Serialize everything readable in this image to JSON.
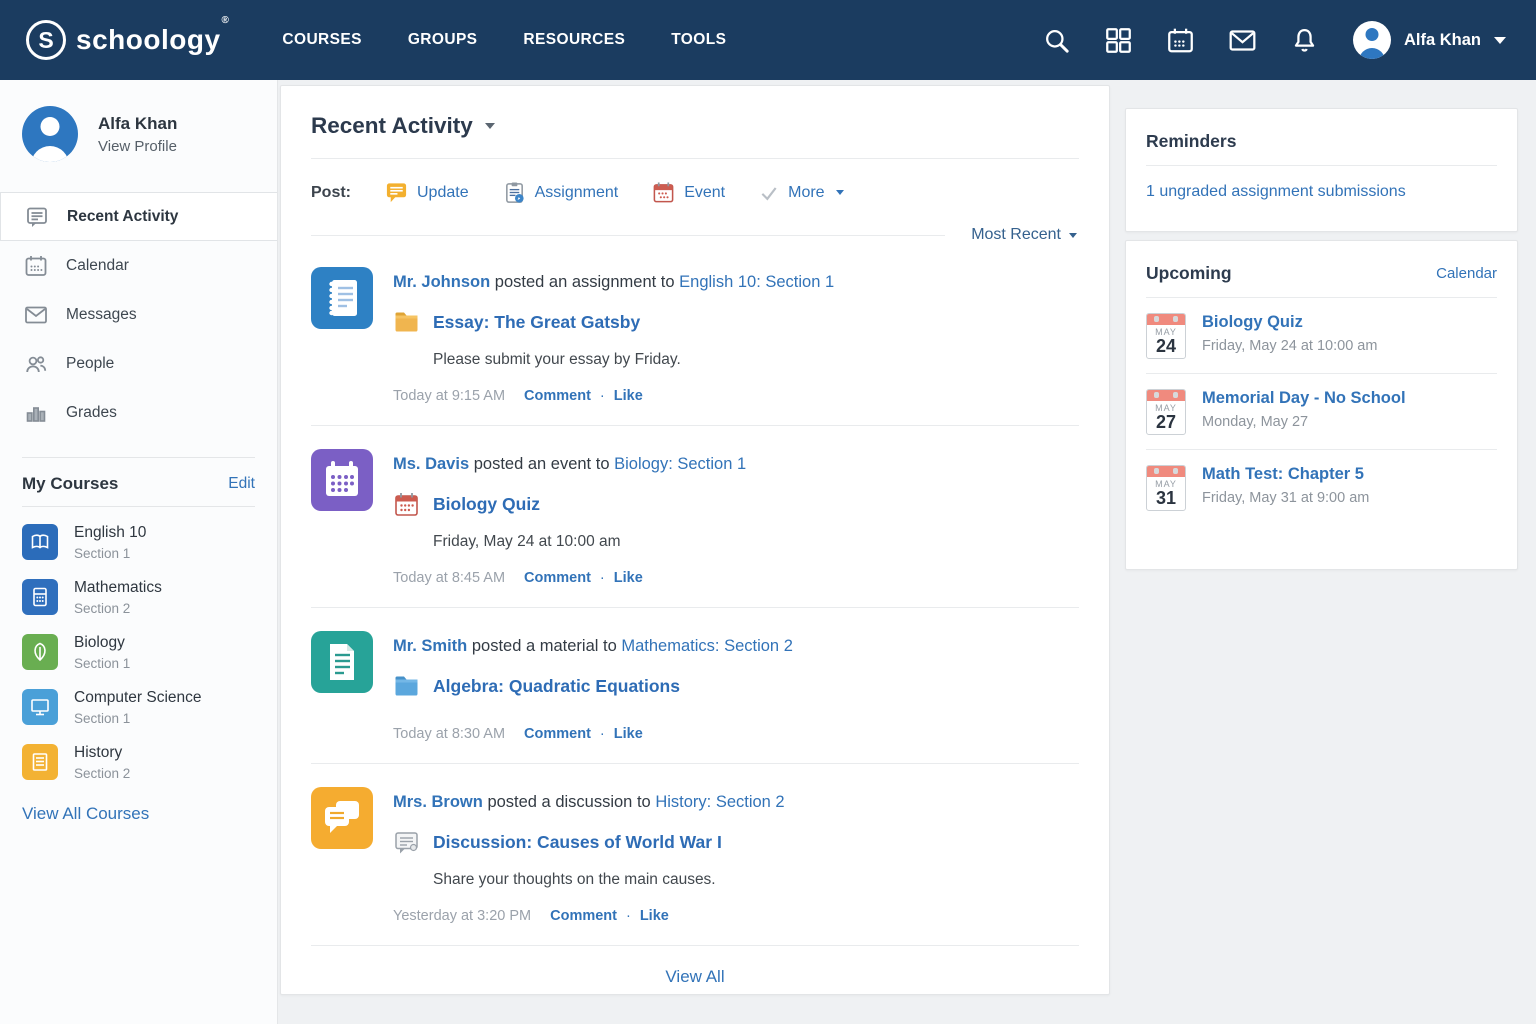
{
  "colors": {
    "navbar": "#1b3c60",
    "link": "#3273b8",
    "tile_assignment": "#2e81c4",
    "tile_event": "#7b5fc5",
    "tile_material": "#27a398",
    "tile_discussion": "#f5ac30",
    "course_english": "#2b6cba",
    "course_math": "#2f6fbd",
    "course_biology": "#69ae51",
    "course_cs": "#4aa0d8",
    "course_history": "#f3b233"
  },
  "navbar": {
    "brand": "schoology",
    "brand_mark": "®",
    "brand_initial": "S",
    "links": [
      {
        "label": "COURSES"
      },
      {
        "label": "GROUPS"
      },
      {
        "label": "RESOURCES"
      },
      {
        "label": "TOOLS"
      }
    ],
    "icons": [
      "search",
      "app-grid",
      "calendar",
      "messages",
      "notifications"
    ],
    "user_name": "Alfa Khan"
  },
  "sidebar": {
    "profile": {
      "name": "Alfa Khan",
      "link": "View Profile"
    },
    "items": [
      {
        "label": "Recent Activity",
        "icon": "post",
        "selected": true
      },
      {
        "label": "Calendar",
        "icon": "calendar",
        "selected": false
      },
      {
        "label": "Messages",
        "icon": "envelope",
        "selected": false
      },
      {
        "label": "People",
        "icon": "people",
        "selected": false
      },
      {
        "label": "Grades",
        "icon": "bar-chart",
        "selected": false
      }
    ],
    "courses": {
      "title": "My Courses",
      "edit": "Edit",
      "list": [
        {
          "name": "English 10",
          "section": "Section 1"
        },
        {
          "name": "Mathematics",
          "section": "Section 2"
        },
        {
          "name": "Biology",
          "section": "Section 1"
        },
        {
          "name": "Computer Science",
          "section": "Section 1"
        },
        {
          "name": "History",
          "section": "Section 2"
        }
      ],
      "view_all": "View All Courses"
    }
  },
  "feed": {
    "title": "Recent Activity",
    "post_label": "Post:",
    "actions": [
      {
        "label": "Update",
        "icon": "update-bubble"
      },
      {
        "label": "Assignment",
        "icon": "assignment-clipboard"
      },
      {
        "label": "Event",
        "icon": "event-calendar"
      },
      {
        "label": "More",
        "icon": "check"
      }
    ],
    "sort": "Most Recent",
    "meta_separator": "·",
    "items": [
      {
        "author": "Mr. Johnson",
        "action": "posted an assignment to",
        "course": "English 10: Section 1",
        "attachment": "Essay: The Great Gatsby",
        "attachment_icon": "folder-yellow",
        "body": "Please submit your essay by Friday.",
        "time": "Today at 9:15 AM",
        "comment": "Comment",
        "like": "Like"
      },
      {
        "author": "Ms. Davis",
        "action": "posted an event to",
        "course": "Biology: Section 1",
        "attachment": "Biology Quiz",
        "attachment_icon": "mini-calendar-red",
        "body": "Friday, May 24 at 10:00 am",
        "time": "Today at 8:45 AM",
        "comment": "Comment",
        "like": "Like"
      },
      {
        "author": "Mr. Smith",
        "action": "posted a material to",
        "course": "Mathematics: Section 2",
        "attachment": "Algebra: Quadratic Equations",
        "attachment_icon": "folder-blue",
        "body": "",
        "time": "Today at 8:30 AM",
        "comment": "Comment",
        "like": "Like"
      },
      {
        "author": "Mrs. Brown",
        "action": "posted a discussion to",
        "course": "History: Section 2",
        "attachment": "Discussion: Causes of World War I",
        "attachment_icon": "discussion-gray",
        "body": "Share your thoughts on the main causes.",
        "time": "Yesterday at 3:20 PM",
        "comment": "Comment",
        "like": "Like"
      }
    ],
    "view_all": "View All"
  },
  "reminders": {
    "title": "Reminders",
    "link": "1 ungraded assignment submissions"
  },
  "upcoming": {
    "title": "Upcoming",
    "calendar_link": "Calendar",
    "events": [
      {
        "month": "MAY",
        "day": "24",
        "title": "Biology Quiz",
        "time": "Friday, May 24 at 10:00 am"
      },
      {
        "month": "MAY",
        "day": "27",
        "title": "Memorial Day - No School",
        "time": "Monday, May 27"
      },
      {
        "month": "MAY",
        "day": "31",
        "title": "Math Test: Chapter 5",
        "time": "Friday, May 31 at 9:00 am"
      }
    ]
  }
}
